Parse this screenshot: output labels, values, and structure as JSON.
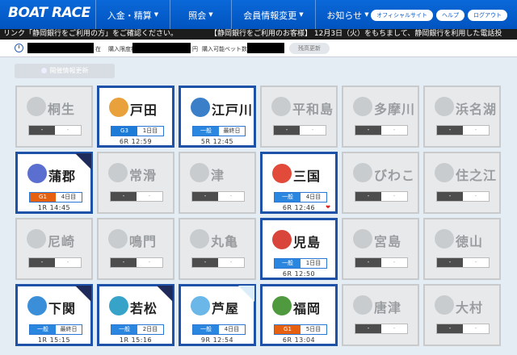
{
  "header": {
    "logo": "BOAT RACE",
    "nav": [
      "入金・精算",
      "照会",
      "会員情報変更",
      "お知らせ"
    ],
    "buttons": [
      "オフィシャルサイト",
      "ヘルプ",
      "ログアウト"
    ]
  },
  "ticker": {
    "left": "リンク「静岡銀行をご利用の方」をご確認ください。",
    "right": "【静岡銀行をご利用のお客様】 12月3日（火）をもちまして、静岡銀行を利用した電話投"
  },
  "infobar": {
    "now_label": "在",
    "limit_label": "購入限度額",
    "yen": "円",
    "bets_label": "購入可能ベット数",
    "refresh": "残高更新"
  },
  "board": {
    "open_info_button": "開催情報更新"
  },
  "venues": [
    {
      "name": "桐生",
      "grade": "-",
      "day": "-",
      "race": "",
      "time": "",
      "active": false,
      "mascot": "#c9cccf"
    },
    {
      "name": "戸田",
      "grade": "G3",
      "gradeClass": "g3",
      "day": "1日目",
      "race": "6R",
      "time": "12:59",
      "active": true,
      "mascot": "#e9a23b"
    },
    {
      "name": "江戸川",
      "grade": "一般",
      "gradeClass": "ippan",
      "day": "最終日",
      "race": "5R",
      "time": "12:45",
      "active": true,
      "mascot": "#3a7fc8"
    },
    {
      "name": "平和島",
      "grade": "-",
      "day": "-",
      "race": "",
      "time": "",
      "active": false
    },
    {
      "name": "多摩川",
      "grade": "-",
      "day": "-",
      "race": "",
      "time": "",
      "active": false
    },
    {
      "name": "浜名湖",
      "grade": "-",
      "day": "-",
      "race": "",
      "time": "",
      "active": false
    },
    {
      "name": "蒲郡",
      "grade": "G1",
      "gradeClass": "g1",
      "day": "4日目",
      "race": "1R",
      "time": "14:45",
      "active": true,
      "mascot": "#5b6fd0",
      "corner": "dark"
    },
    {
      "name": "常滑",
      "grade": "-",
      "day": "-",
      "race": "",
      "time": "",
      "active": false
    },
    {
      "name": "津",
      "grade": "-",
      "day": "-",
      "race": "",
      "time": "",
      "active": false
    },
    {
      "name": "三国",
      "grade": "一般",
      "gradeClass": "ippan",
      "day": "4日目",
      "race": "6R",
      "time": "12:46",
      "active": true,
      "mascot": "#e24a3a",
      "heart": "❤"
    },
    {
      "name": "びわこ",
      "grade": "-",
      "day": "-",
      "race": "",
      "time": "",
      "active": false
    },
    {
      "name": "住之江",
      "grade": "-",
      "day": "-",
      "race": "",
      "time": "",
      "active": false
    },
    {
      "name": "尼崎",
      "grade": "-",
      "day": "-",
      "race": "",
      "time": "",
      "active": false
    },
    {
      "name": "鳴門",
      "grade": "-",
      "day": "-",
      "race": "",
      "time": "",
      "active": false
    },
    {
      "name": "丸亀",
      "grade": "-",
      "day": "-",
      "race": "",
      "time": "",
      "active": false
    },
    {
      "name": "児島",
      "grade": "一般",
      "gradeClass": "ippan",
      "day": "1日目",
      "race": "6R",
      "time": "12:50",
      "active": true,
      "mascot": "#d9453b"
    },
    {
      "name": "宮島",
      "grade": "-",
      "day": "-",
      "race": "",
      "time": "",
      "active": false
    },
    {
      "name": "徳山",
      "grade": "-",
      "day": "-",
      "race": "",
      "time": "",
      "active": false
    },
    {
      "name": "下関",
      "grade": "一般",
      "gradeClass": "ippan",
      "day": "最終日",
      "race": "1R",
      "time": "15:15",
      "active": true,
      "mascot": "#3a8fd8",
      "corner": "dark"
    },
    {
      "name": "若松",
      "grade": "一般",
      "gradeClass": "ippan",
      "day": "2日目",
      "race": "1R",
      "time": "15:16",
      "active": true,
      "mascot": "#38a3c9",
      "corner": "dark"
    },
    {
      "name": "芦屋",
      "grade": "一般",
      "gradeClass": "ippan",
      "day": "4日目",
      "race": "9R",
      "time": "12:54",
      "active": true,
      "mascot": "#6ab7e8",
      "corner": "light"
    },
    {
      "name": "福岡",
      "grade": "G1",
      "gradeClass": "g1",
      "day": "5日目",
      "race": "6R",
      "time": "13:04",
      "active": true,
      "mascot": "#4f9a3e"
    },
    {
      "name": "唐津",
      "grade": "-",
      "day": "-",
      "race": "",
      "time": "",
      "active": false
    },
    {
      "name": "大村",
      "grade": "-",
      "day": "-",
      "race": "",
      "time": "",
      "active": false
    }
  ]
}
